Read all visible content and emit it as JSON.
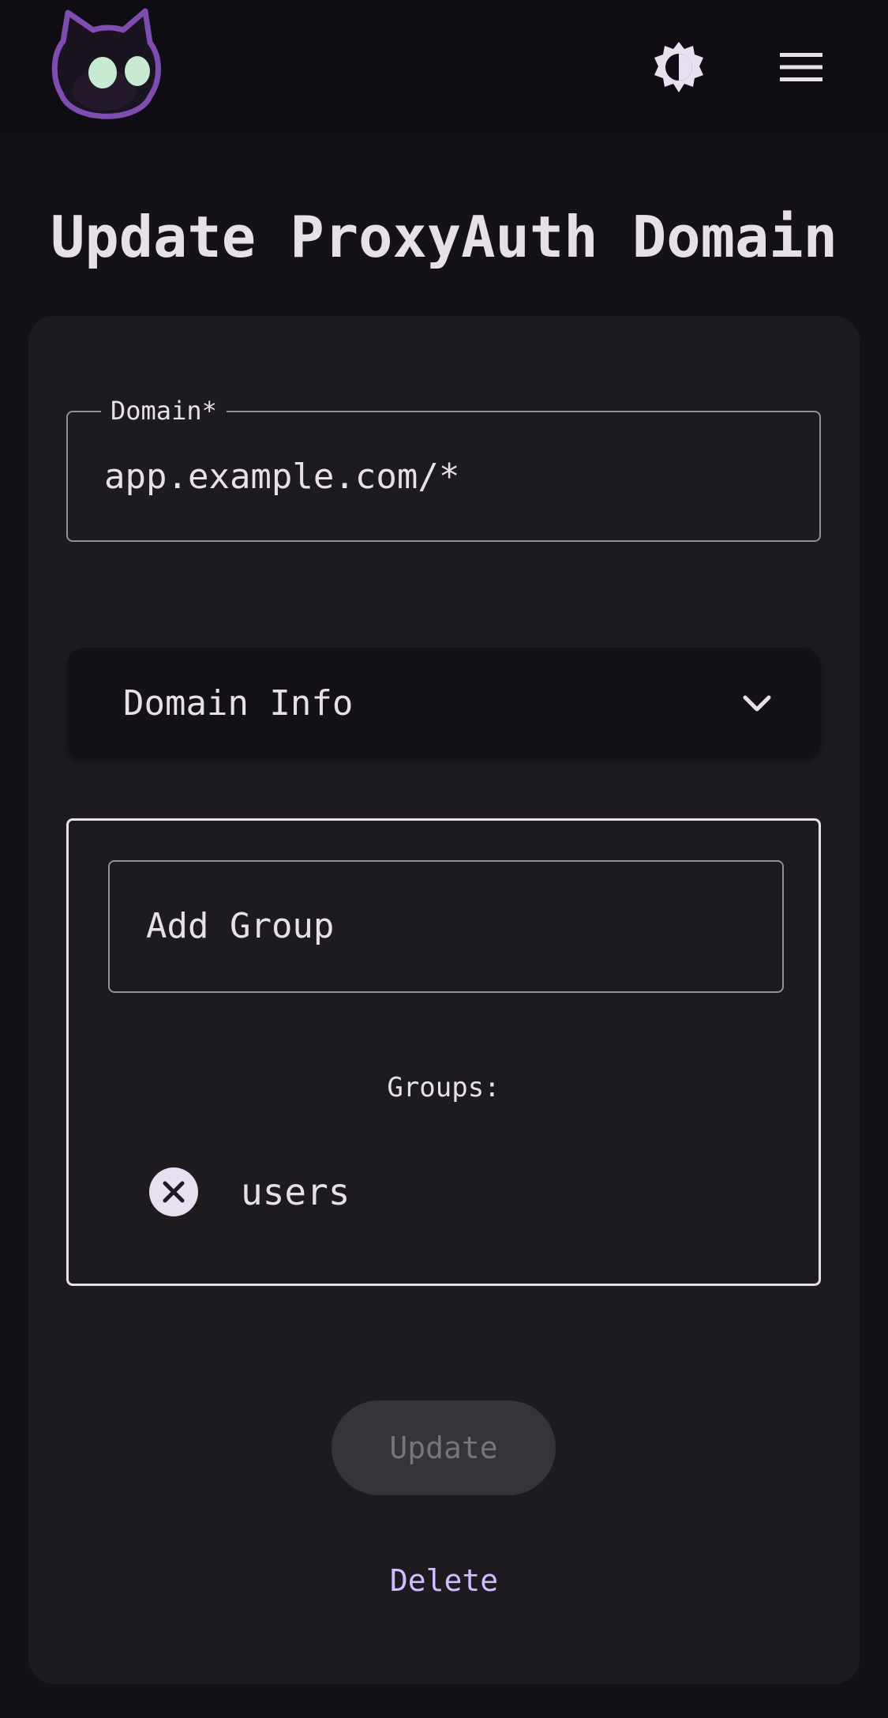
{
  "header": {
    "logo_icon": "cat-logo-icon",
    "theme_toggle_icon": "contrast-icon",
    "menu_icon": "hamburger-menu-icon"
  },
  "page": {
    "title": "Update ProxyAuth Domain"
  },
  "form": {
    "domain_label": "Domain*",
    "domain_value": "app.example.com/*",
    "accordion_label": "Domain Info",
    "accordion_icon": "chevron-down-icon",
    "add_group_placeholder": "Add Group",
    "groups_heading": "Groups:",
    "groups": [
      {
        "name": "users",
        "remove_icon": "close-circle-icon"
      }
    ],
    "update_label": "Update",
    "delete_label": "Delete"
  },
  "colors": {
    "background": "#141218",
    "topbar": "#0f0d13",
    "card": "#1d1b20",
    "text": "#e6e0e9",
    "outline": "#938f99",
    "accent": "#d0bcff",
    "disabled_button": "#36343b",
    "disabled_text": "#77747c",
    "logo_outline": "#7e4db0",
    "logo_eyes": "#c8ead2"
  }
}
